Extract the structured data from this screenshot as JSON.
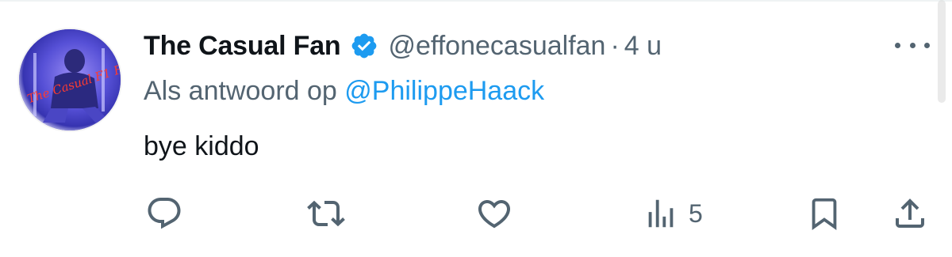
{
  "tweet": {
    "display_name": "The Casual Fan",
    "handle": "@effonecasualfan",
    "separator": "·",
    "time": "4 u",
    "reply_prefix": "Als antwoord op",
    "reply_mention": "@PhilippeHaack",
    "text": "bye kiddo",
    "avatar_text": "The Casual F1 Fan",
    "verified_icon": "verified-badge-icon",
    "more_icon": "more-options-icon"
  },
  "actions": {
    "reply_icon": "reply-icon",
    "retweet_icon": "retweet-icon",
    "like_icon": "like-icon",
    "views_icon": "views-icon",
    "views_count": "5",
    "bookmark_icon": "bookmark-icon",
    "share_icon": "share-icon"
  },
  "colors": {
    "primary_text": "#0f1419",
    "secondary_text": "#536471",
    "accent": "#1d9bf0"
  }
}
